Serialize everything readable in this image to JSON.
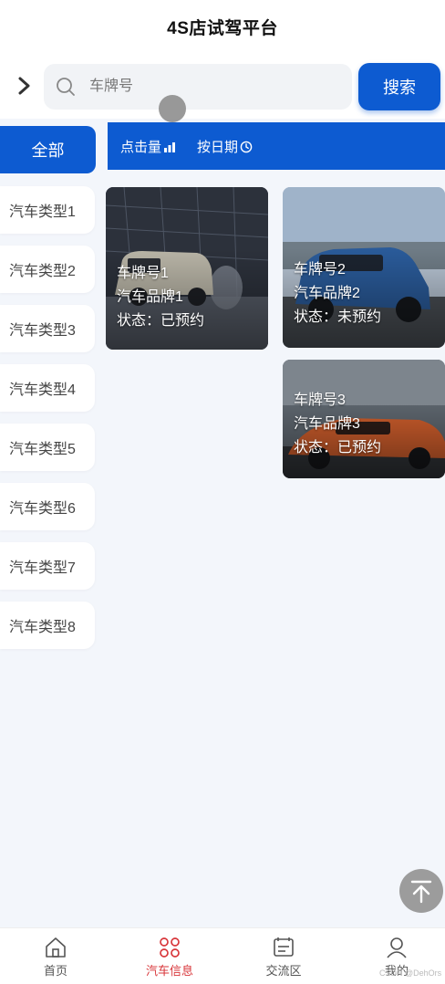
{
  "header": {
    "title": "4S店试驾平台"
  },
  "search": {
    "placeholder": "车牌号",
    "button_label": "搜索"
  },
  "filter": {
    "all_label": "全部",
    "sort_by_clicks": "点击量",
    "sort_by_date": "按日期"
  },
  "categories": [
    "汽车类型1",
    "汽车类型2",
    "汽车类型3",
    "汽车类型4",
    "汽车类型5",
    "汽车类型6",
    "汽车类型7",
    "汽车类型8"
  ],
  "cars": [
    {
      "plate": "车牌号1",
      "brand": "汽车品牌1",
      "status": "状态：已预约"
    },
    {
      "plate": "车牌号2",
      "brand": "汽车品牌2",
      "status": "状态：未预约"
    },
    {
      "plate": "车牌号3",
      "brand": "汽车品牌3",
      "status": "状态：已预约"
    }
  ],
  "tabbar": {
    "items": [
      "首页",
      "汽车信息",
      "交流区",
      "我的"
    ],
    "active": "汽车信息"
  },
  "watermark": "CSDN @DehOrs",
  "colors": {
    "primary": "#0d5bd1",
    "active_tab": "#d8363a",
    "background": "#f3f6fb"
  },
  "icons": [
    "chevron-right-icon",
    "search-icon",
    "bar-chart-icon",
    "clock-icon",
    "back-to-top-icon",
    "home-icon",
    "car-info-icon",
    "forum-icon",
    "user-icon"
  ]
}
